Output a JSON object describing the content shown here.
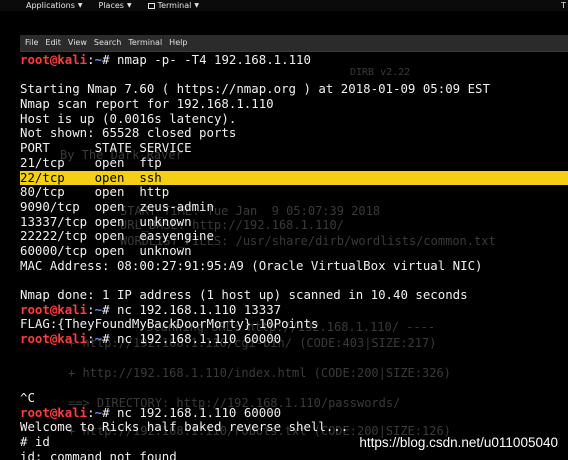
{
  "topbar": {
    "applications": "Applications",
    "places": "Places",
    "terminal": "Terminal"
  },
  "menubar": {
    "items": [
      "File",
      "Edit",
      "View",
      "Search",
      "Terminal",
      "Help"
    ]
  },
  "terminal": {
    "prompt_user": "root@kali",
    "prompt_path": "~",
    "lines": [
      {
        "type": "prompt",
        "cmd": " nmap -p- -T4 192.168.1.110"
      },
      {
        "type": "text",
        "text": ""
      },
      {
        "type": "text",
        "text": "Starting Nmap 7.60 ( https://nmap.org ) at 2018-01-09 05:09 EST"
      },
      {
        "type": "text",
        "text": "Nmap scan report for 192.168.1.110"
      },
      {
        "type": "text",
        "text": "Host is up (0.0016s latency)."
      },
      {
        "type": "text",
        "text": "Not shown: 65528 closed ports"
      },
      {
        "type": "text",
        "text": "PORT      STATE SERVICE"
      },
      {
        "type": "text",
        "text": "21/tcp    open  ftp"
      },
      {
        "type": "highlight",
        "text": "22/tcp    open  ssh"
      },
      {
        "type": "text",
        "text": "80/tcp    open  http"
      },
      {
        "type": "text",
        "text": "9090/tcp  open  zeus-admin"
      },
      {
        "type": "text",
        "text": "13337/tcp open  unknown"
      },
      {
        "type": "text",
        "text": "22222/tcp open  easyengine"
      },
      {
        "type": "text",
        "text": "60000/tcp open  unknown"
      },
      {
        "type": "text",
        "text": "MAC Address: 08:00:27:91:95:A9 (Oracle VirtualBox virtual NIC)"
      },
      {
        "type": "text",
        "text": ""
      },
      {
        "type": "text",
        "text": "Nmap done: 1 IP address (1 host up) scanned in 10.40 seconds"
      },
      {
        "type": "prompt",
        "cmd": " nc 192.168.1.110 13337"
      },
      {
        "type": "text",
        "text": "FLAG:{TheyFoundMyBackDoorMorty}-10Points"
      },
      {
        "type": "prompt",
        "cmd": " nc 192.168.1.110 60000"
      },
      {
        "type": "text",
        "text": ""
      },
      {
        "type": "text",
        "text": ""
      },
      {
        "type": "text",
        "text": ""
      },
      {
        "type": "text",
        "text": "^C"
      },
      {
        "type": "prompt",
        "cmd": " nc 192.168.1.110 60000"
      },
      {
        "type": "text",
        "text": "Welcome to Ricks half baked reverse shell..."
      },
      {
        "type": "text",
        "text": "# id"
      },
      {
        "type": "text",
        "text": "id: command not found"
      }
    ]
  },
  "background_ghost": [
    "DIRB v2.22",
    "By The Dark Raver",
    "START_TIME: Tue Jan  9 05:07:39 2018",
    "URL_BASE: http://192.168.1.110/",
    "WORDLIST_FILES: /usr/share/dirb/wordlists/common.txt",
    "---- Scanning URL: http://192.168.1.110/ ----",
    "+ http://192.168.1.110/cgi-bin/ (CODE:403|SIZE:217)",
    "+ http://192.168.1.110/index.html (CODE:200|SIZE:326)",
    "==> DIRECTORY: http://192.168.1.110/passwords/",
    "+ http://192.168.1.110/robots.txt (CODE:200|SIZE:126)"
  ],
  "watermark": "https://blog.csdn.net/u011005040"
}
